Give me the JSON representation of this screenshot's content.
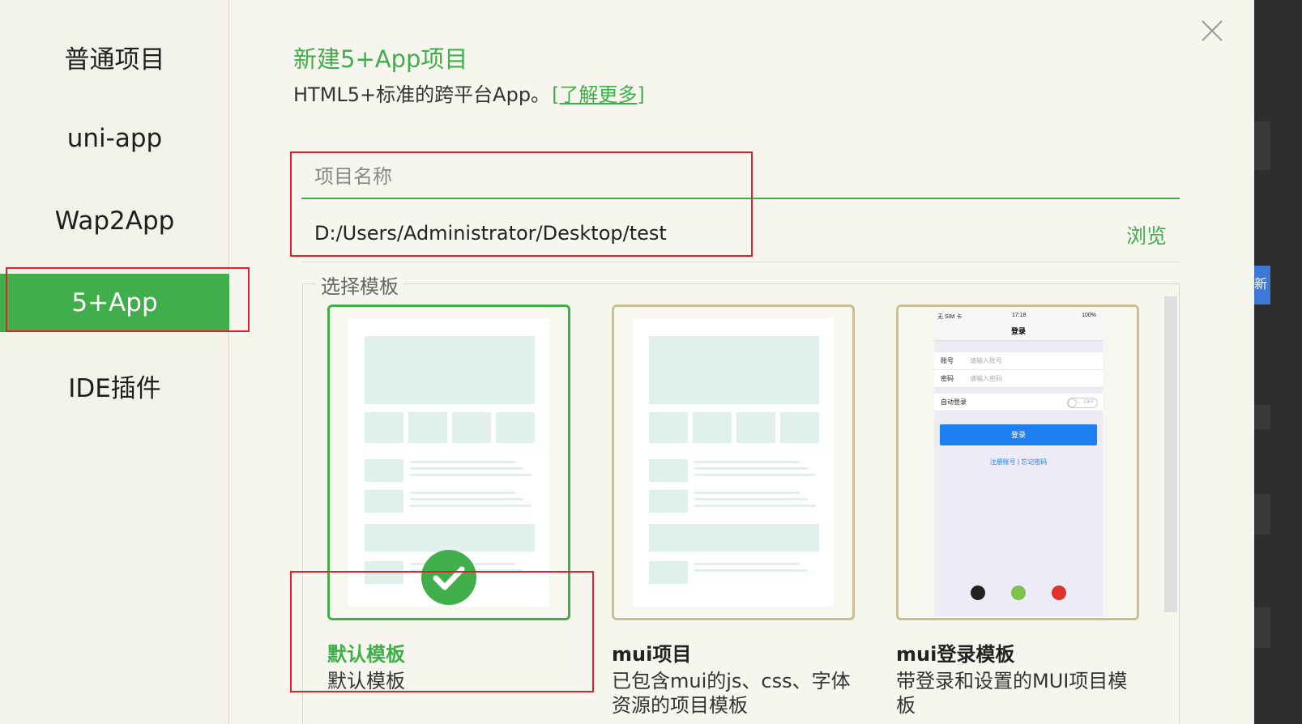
{
  "sidebar": {
    "items": [
      {
        "label": "普通项目"
      },
      {
        "label": "uni-app"
      },
      {
        "label": "Wap2App"
      },
      {
        "label": "5+App",
        "active": true
      },
      {
        "label": "IDE插件"
      }
    ]
  },
  "header": {
    "title": "新建5+App项目",
    "subtitle": "HTML5+标准的跨平台App。",
    "learn_more": "[了解更多]"
  },
  "form": {
    "name_placeholder": "项目名称",
    "name_value": "",
    "path": "D:/Users/Administrator/Desktop/test",
    "browse_label": "浏览"
  },
  "templates": {
    "legend": "选择模板",
    "items": [
      {
        "title": "默认模板",
        "desc": "默认模板",
        "selected": true
      },
      {
        "title": "mui项目",
        "desc": "已包含mui的js、css、字体资源的项目模板"
      },
      {
        "title": "mui登录模板",
        "desc": "带登录和设置的MUI项目模板"
      }
    ]
  },
  "phone_mock": {
    "carrier": "无 SIM 卡",
    "time": "17:18",
    "battery": "100%",
    "nav_title": "登录",
    "account_label": "账号",
    "account_placeholder": "请输入账号",
    "password_label": "密码",
    "password_placeholder": "请输入密码",
    "auto_login": "自动登录",
    "toggle": "OFF",
    "login_button": "登录",
    "links": "注册账号 | 忘记密码"
  },
  "right_strip": {
    "label": "新"
  },
  "colors": {
    "accent": "#3fae4b",
    "highlight_box": "#e0212b",
    "card_border": "#c9bf93"
  }
}
